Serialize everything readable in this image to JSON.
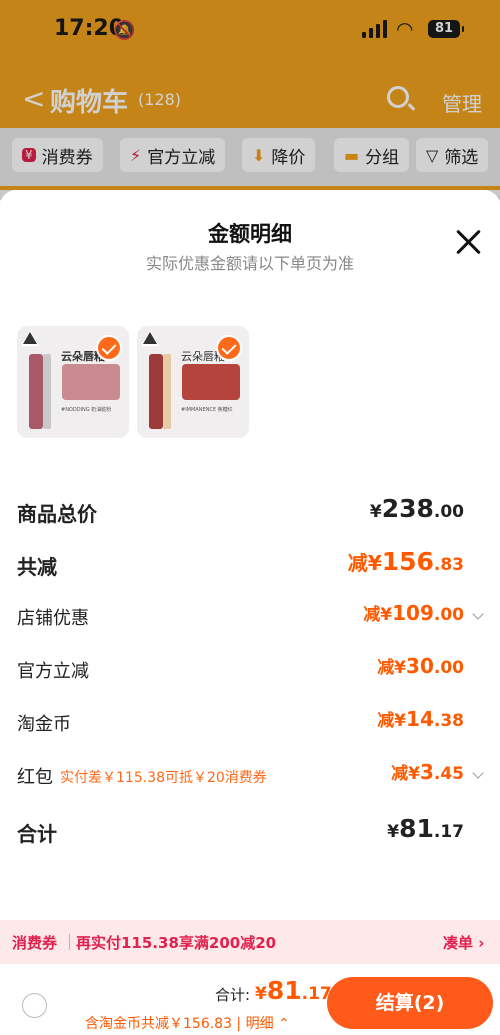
{
  "status_bar": {
    "time": "17:20",
    "battery": "81"
  },
  "header": {
    "back": "<",
    "title": "购物车",
    "count": "(128)",
    "manage": "管理"
  },
  "filters": [
    {
      "icon": "¥",
      "label": "消费券"
    },
    {
      "icon": "⚡",
      "label": "官方立减"
    },
    {
      "icon": "⬇",
      "label": "降价"
    },
    {
      "icon": "▬",
      "label": "分组"
    },
    {
      "icon": "▽",
      "label": "筛选"
    }
  ],
  "sheet": {
    "title": "金额明细",
    "subtitle": "实际优惠金额请以下单页为准",
    "products": [
      {
        "name": "云朵唇釉",
        "shade": "#NODDING 奶油脏粉",
        "tube_color": "#a85a6a",
        "lip_color": "#c98a90"
      },
      {
        "name": "云朵唇釉",
        "shade": "#IMMANENCE 焦糖红",
        "tube_color": "#9c3a3a",
        "lip_color": "#b4443c"
      }
    ],
    "rows": [
      {
        "label": "商品总价",
        "prefix": "¥",
        "int": "238",
        "dec": ".00",
        "style": "total"
      },
      {
        "label": "共减",
        "prefix": "减¥",
        "int": "156",
        "dec": ".83",
        "style": "discount-total"
      },
      {
        "label": "店铺优惠",
        "prefix": "减¥",
        "int": "109",
        "dec": ".00",
        "style": "item",
        "chevron": true
      },
      {
        "label": "官方立减",
        "prefix": "减¥",
        "int": "30",
        "dec": ".00",
        "style": "item"
      },
      {
        "label": "淘金币",
        "prefix": "减¥",
        "int": "14",
        "dec": ".38",
        "style": "item"
      },
      {
        "label": "红包",
        "note": "实付差￥115.38可抵￥20消费券",
        "prefix": "减¥",
        "int": "3",
        "dec": ".45",
        "style": "item",
        "chevron": true
      },
      {
        "label": "合计",
        "prefix": "¥",
        "int": "81",
        "dec": ".17",
        "style": "total"
      }
    ]
  },
  "voucher_bar": {
    "tag": "消费券",
    "text": "再实付115.38享满200减20",
    "link": "凑单 ›"
  },
  "checkout": {
    "total_label": "合计:",
    "prefix": "¥",
    "int": "81",
    "dec": ".17",
    "detail": "含淘金币共减￥156.83 | 明细 ⌃",
    "pay_button": "结算(2)"
  },
  "colors": {
    "accent": "#ff5a00",
    "header": "#f1a21d",
    "voucher_text": "#e0224f"
  }
}
